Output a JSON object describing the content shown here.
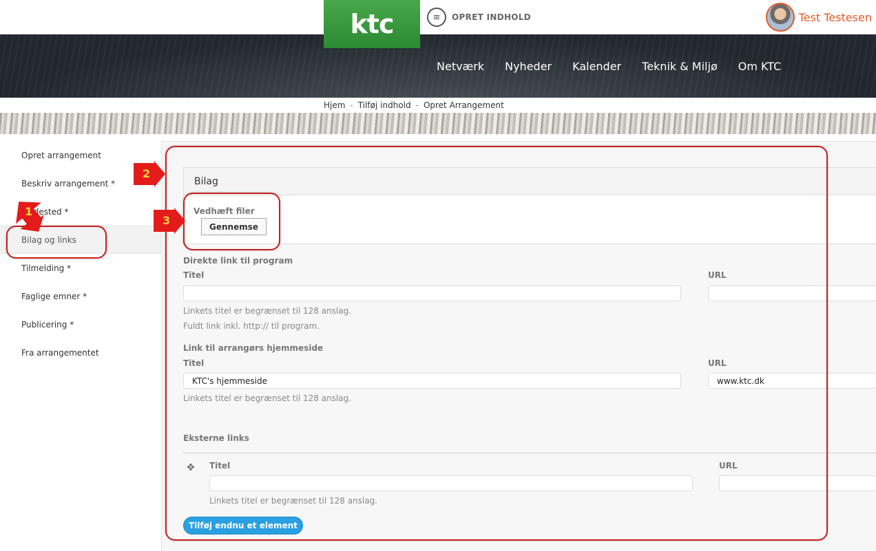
{
  "header": {
    "logo": "ktc",
    "create_label": "OPRET INDHOLD",
    "user_name": "Test Testesen"
  },
  "nav": {
    "items": [
      "Netværk",
      "Nyheder",
      "Kalender",
      "Teknik & Miljø",
      "Om KTC"
    ]
  },
  "breadcrumb": [
    "Hjem",
    "Tilføj indhold",
    "Opret Arrangement"
  ],
  "sidebar": {
    "items": [
      "Opret arrangement",
      "Beskriv arrangement *",
      "Mødested *",
      "Bilag og links",
      "Tilmelding *",
      "Faglige emner *",
      "Publicering *",
      "Fra arrangementet"
    ],
    "active_index": 3
  },
  "attachments": {
    "legend": "Bilag",
    "label": "Vedhæft filer",
    "browse_button": "Gennemse"
  },
  "program_link": {
    "heading": "Direkte link til program",
    "title_label": "Titel",
    "url_label": "URL",
    "title_value": "",
    "url_value": "",
    "help_title": "Linkets titel er begrænset til 128 anslag.",
    "help_url": "Fuldt link inkl. http:// til program."
  },
  "organizer_link": {
    "heading": "Link til arrangørs hjemmeside",
    "title_label": "Titel",
    "url_label": "URL",
    "title_value": "KTC's hjemmeside",
    "url_value": "www.ktc.dk",
    "help_title": "Linkets titel er begrænset til 128 anslag."
  },
  "external_links": {
    "heading": "Eksterne links",
    "title_label": "Titel",
    "url_label": "URL",
    "title_value": "",
    "url_value": "",
    "help_title": "Linkets titel er begrænset til 128 anslag.",
    "add_button": "Tilføj endnu et element"
  },
  "annotations": [
    "1",
    "2",
    "3"
  ],
  "colors": {
    "brand_green": "#3a9a3f",
    "accent_orange": "#e05a28",
    "button_blue": "#2aa0e2",
    "annotation_red": "#c81e1e"
  }
}
